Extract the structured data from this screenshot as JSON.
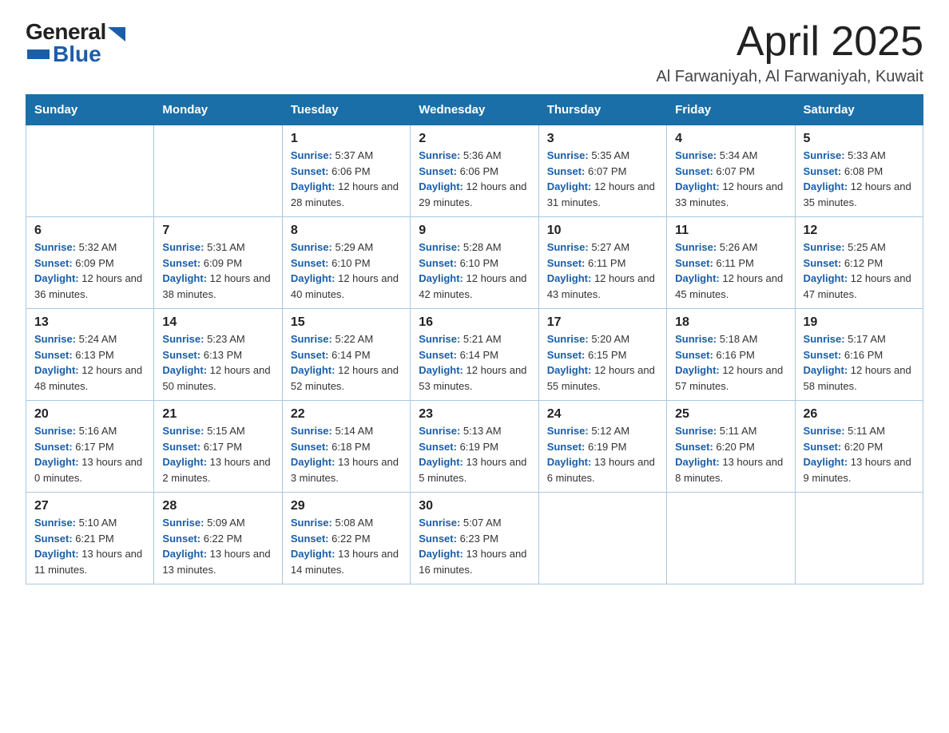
{
  "logo": {
    "general": "General",
    "blue": "Blue",
    "arrow_color": "#1a5ea8"
  },
  "title": {
    "main": "April 2025",
    "sub": "Al Farwaniyah, Al Farwaniyah, Kuwait"
  },
  "weekdays": [
    "Sunday",
    "Monday",
    "Tuesday",
    "Wednesday",
    "Thursday",
    "Friday",
    "Saturday"
  ],
  "weeks": [
    [
      {
        "num": "",
        "sunrise": "",
        "sunset": "",
        "daylight": ""
      },
      {
        "num": "",
        "sunrise": "",
        "sunset": "",
        "daylight": ""
      },
      {
        "num": "1",
        "sunrise": "5:37 AM",
        "sunset": "6:06 PM",
        "daylight": "12 hours and 28 minutes."
      },
      {
        "num": "2",
        "sunrise": "5:36 AM",
        "sunset": "6:06 PM",
        "daylight": "12 hours and 29 minutes."
      },
      {
        "num": "3",
        "sunrise": "5:35 AM",
        "sunset": "6:07 PM",
        "daylight": "12 hours and 31 minutes."
      },
      {
        "num": "4",
        "sunrise": "5:34 AM",
        "sunset": "6:07 PM",
        "daylight": "12 hours and 33 minutes."
      },
      {
        "num": "5",
        "sunrise": "5:33 AM",
        "sunset": "6:08 PM",
        "daylight": "12 hours and 35 minutes."
      }
    ],
    [
      {
        "num": "6",
        "sunrise": "5:32 AM",
        "sunset": "6:09 PM",
        "daylight": "12 hours and 36 minutes."
      },
      {
        "num": "7",
        "sunrise": "5:31 AM",
        "sunset": "6:09 PM",
        "daylight": "12 hours and 38 minutes."
      },
      {
        "num": "8",
        "sunrise": "5:29 AM",
        "sunset": "6:10 PM",
        "daylight": "12 hours and 40 minutes."
      },
      {
        "num": "9",
        "sunrise": "5:28 AM",
        "sunset": "6:10 PM",
        "daylight": "12 hours and 42 minutes."
      },
      {
        "num": "10",
        "sunrise": "5:27 AM",
        "sunset": "6:11 PM",
        "daylight": "12 hours and 43 minutes."
      },
      {
        "num": "11",
        "sunrise": "5:26 AM",
        "sunset": "6:11 PM",
        "daylight": "12 hours and 45 minutes."
      },
      {
        "num": "12",
        "sunrise": "5:25 AM",
        "sunset": "6:12 PM",
        "daylight": "12 hours and 47 minutes."
      }
    ],
    [
      {
        "num": "13",
        "sunrise": "5:24 AM",
        "sunset": "6:13 PM",
        "daylight": "12 hours and 48 minutes."
      },
      {
        "num": "14",
        "sunrise": "5:23 AM",
        "sunset": "6:13 PM",
        "daylight": "12 hours and 50 minutes."
      },
      {
        "num": "15",
        "sunrise": "5:22 AM",
        "sunset": "6:14 PM",
        "daylight": "12 hours and 52 minutes."
      },
      {
        "num": "16",
        "sunrise": "5:21 AM",
        "sunset": "6:14 PM",
        "daylight": "12 hours and 53 minutes."
      },
      {
        "num": "17",
        "sunrise": "5:20 AM",
        "sunset": "6:15 PM",
        "daylight": "12 hours and 55 minutes."
      },
      {
        "num": "18",
        "sunrise": "5:18 AM",
        "sunset": "6:16 PM",
        "daylight": "12 hours and 57 minutes."
      },
      {
        "num": "19",
        "sunrise": "5:17 AM",
        "sunset": "6:16 PM",
        "daylight": "12 hours and 58 minutes."
      }
    ],
    [
      {
        "num": "20",
        "sunrise": "5:16 AM",
        "sunset": "6:17 PM",
        "daylight": "13 hours and 0 minutes."
      },
      {
        "num": "21",
        "sunrise": "5:15 AM",
        "sunset": "6:17 PM",
        "daylight": "13 hours and 2 minutes."
      },
      {
        "num": "22",
        "sunrise": "5:14 AM",
        "sunset": "6:18 PM",
        "daylight": "13 hours and 3 minutes."
      },
      {
        "num": "23",
        "sunrise": "5:13 AM",
        "sunset": "6:19 PM",
        "daylight": "13 hours and 5 minutes."
      },
      {
        "num": "24",
        "sunrise": "5:12 AM",
        "sunset": "6:19 PM",
        "daylight": "13 hours and 6 minutes."
      },
      {
        "num": "25",
        "sunrise": "5:11 AM",
        "sunset": "6:20 PM",
        "daylight": "13 hours and 8 minutes."
      },
      {
        "num": "26",
        "sunrise": "5:11 AM",
        "sunset": "6:20 PM",
        "daylight": "13 hours and 9 minutes."
      }
    ],
    [
      {
        "num": "27",
        "sunrise": "5:10 AM",
        "sunset": "6:21 PM",
        "daylight": "13 hours and 11 minutes."
      },
      {
        "num": "28",
        "sunrise": "5:09 AM",
        "sunset": "6:22 PM",
        "daylight": "13 hours and 13 minutes."
      },
      {
        "num": "29",
        "sunrise": "5:08 AM",
        "sunset": "6:22 PM",
        "daylight": "13 hours and 14 minutes."
      },
      {
        "num": "30",
        "sunrise": "5:07 AM",
        "sunset": "6:23 PM",
        "daylight": "13 hours and 16 minutes."
      },
      {
        "num": "",
        "sunrise": "",
        "sunset": "",
        "daylight": ""
      },
      {
        "num": "",
        "sunrise": "",
        "sunset": "",
        "daylight": ""
      },
      {
        "num": "",
        "sunrise": "",
        "sunset": "",
        "daylight": ""
      }
    ]
  ],
  "labels": {
    "sunrise": "Sunrise:",
    "sunset": "Sunset:",
    "daylight": "Daylight:"
  }
}
